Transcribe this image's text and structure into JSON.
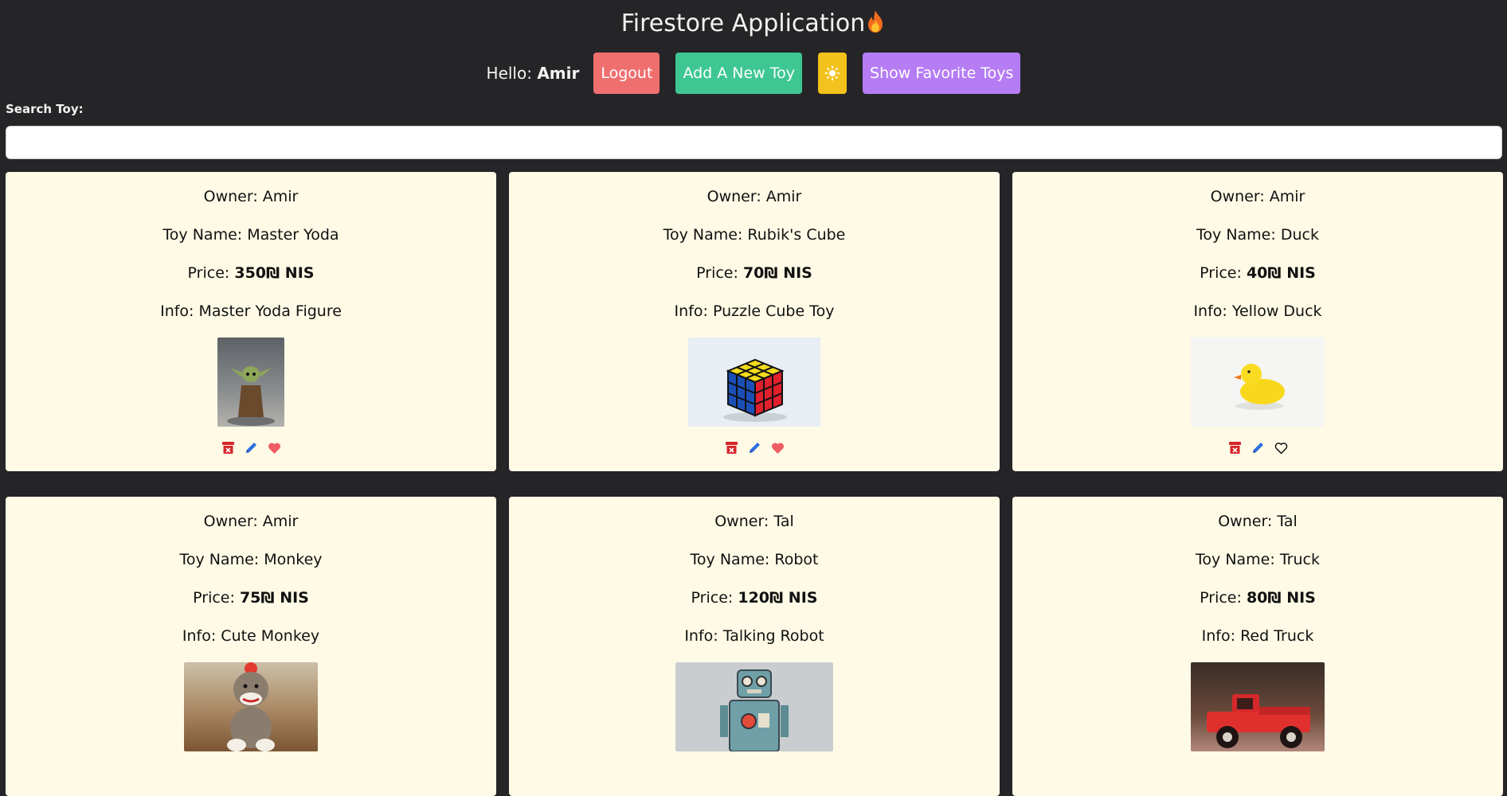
{
  "header": {
    "title": "Firestore Application",
    "fire_icon": "fire-icon",
    "hello_prefix": "Hello:",
    "username": "Amir",
    "logout_label": "Logout",
    "add_label": "Add A New Toy",
    "theme_icon": "sun-icon",
    "favorites_label": "Show Favorite Toys"
  },
  "search": {
    "label": "Search Toy:",
    "value": "",
    "placeholder": ""
  },
  "labels": {
    "owner": "Owner:",
    "toy_name": "Toy Name:",
    "price": "Price:",
    "info": "Info:",
    "currency_suffix": "₪ NIS"
  },
  "toys": [
    {
      "owner": "Amir",
      "name": "Master Yoda",
      "price": "350₪ NIS",
      "info": "Master Yoda Figure",
      "favorite": true,
      "image": "master-yoda-figure-photo"
    },
    {
      "owner": "Amir",
      "name": "Rubik's Cube",
      "price": "70₪ NIS",
      "info": "Puzzle Cube Toy",
      "favorite": true,
      "image": "rubiks-cube-photo"
    },
    {
      "owner": "Amir",
      "name": "Duck",
      "price": "40₪ NIS",
      "info": "Yellow Duck",
      "favorite": false,
      "image": "yellow-duck-photo"
    },
    {
      "owner": "Amir",
      "name": "Monkey",
      "price": "75₪ NIS",
      "info": "Cute Monkey",
      "favorite": null,
      "image": "sock-monkey-photo"
    },
    {
      "owner": "Tal",
      "name": "Robot",
      "price": "120₪ NIS",
      "info": "Talking Robot",
      "favorite": null,
      "image": "tin-robot-photo"
    },
    {
      "owner": "Tal",
      "name": "Truck",
      "price": "80₪ NIS",
      "info": "Red Truck",
      "favorite": null,
      "image": "red-truck-photo"
    }
  ],
  "colors": {
    "background": "#252528",
    "card": "#fefae6",
    "logout": "#ef6f6f",
    "add": "#3ec793",
    "theme": "#f4c21c",
    "favorites": "#b57cf4",
    "delete_icon": "#d6252b",
    "edit_icon": "#2f6fe0",
    "heart_filled": "#ee5c64"
  }
}
